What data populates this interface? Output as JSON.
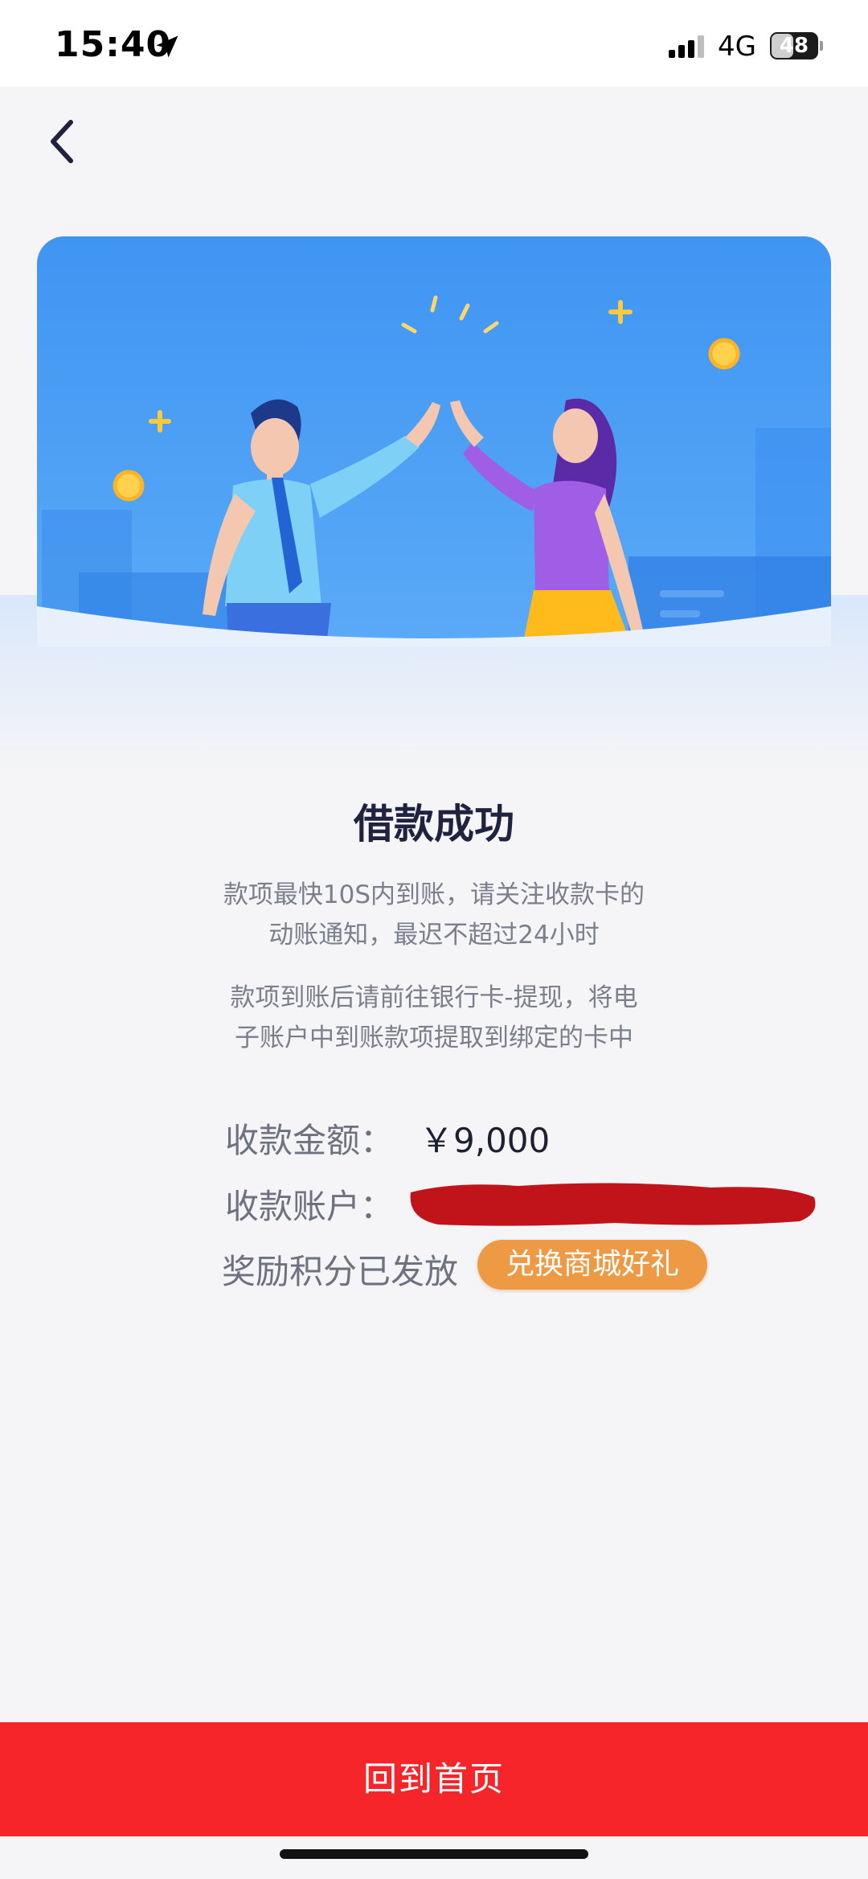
{
  "status_bar": {
    "time": "15:40",
    "network": "4G",
    "battery": "48",
    "battery_fraction": 0.48,
    "icons": [
      "location-arrow-icon",
      "signal-icon",
      "battery-icon"
    ]
  },
  "nav": {
    "back_icon": "chevron-left-icon"
  },
  "banner": {
    "illustration": "high-five-illustration"
  },
  "result": {
    "title": "借款成功",
    "notice_1_line_1": "款项最快10S内到账，请关注收款卡的",
    "notice_1_line_2": "动账通知，最迟不超过24小时",
    "notice_2_line_1": "款项到账后请前往银行卡-提现，将电",
    "notice_2_line_2": "子账户中到账款项提取到绑定的卡中"
  },
  "details": {
    "amount_label": "收款金额：",
    "amount_value": "￥9,000",
    "account_label": "收款账户：",
    "reward_label": "奖励积分已发放",
    "redeem_button": "兑换商城好礼"
  },
  "footer": {
    "home_button": "回到首页"
  },
  "colors": {
    "primary_red": "#f5252a",
    "orange_badge": "#ee9a45",
    "banner_blue": "#4a9af0",
    "redaction": "#c0141a"
  }
}
